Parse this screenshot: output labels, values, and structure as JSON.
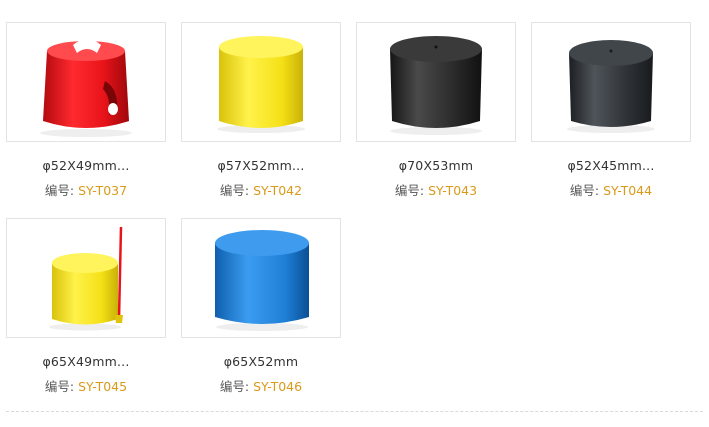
{
  "products": [
    {
      "name": "φ52X49mm...",
      "code_label": "编号:",
      "code": "SY-T037",
      "color": "#e8141a",
      "shape": "red-cap-with-notch"
    },
    {
      "name": "φ57X52mm...",
      "code_label": "编号:",
      "code": "SY-T042",
      "color": "#f5e016",
      "shape": "yellow-cylinder-cap"
    },
    {
      "name": "φ70X53mm",
      "code_label": "编号:",
      "code": "SY-T043",
      "color": "#2a2a2a",
      "shape": "black-cylinder-cap"
    },
    {
      "name": "φ52X45mm...",
      "code_label": "编号:",
      "code": "SY-T044",
      "color": "#2e3236",
      "shape": "dark-gray-cylinder-cap"
    },
    {
      "name": "φ65X49mm...",
      "code_label": "编号:",
      "code": "SY-T045",
      "color": "#f5e016",
      "shape": "yellow-cap-with-pull-tab"
    },
    {
      "name": "φ65X52mm",
      "code_label": "编号:",
      "code": "SY-T046",
      "color": "#1e7fd6",
      "shape": "blue-cylinder-cap"
    }
  ],
  "colors": {
    "code_value": "#d99a1a",
    "text": "#333333",
    "border": "#e3e3e3"
  }
}
